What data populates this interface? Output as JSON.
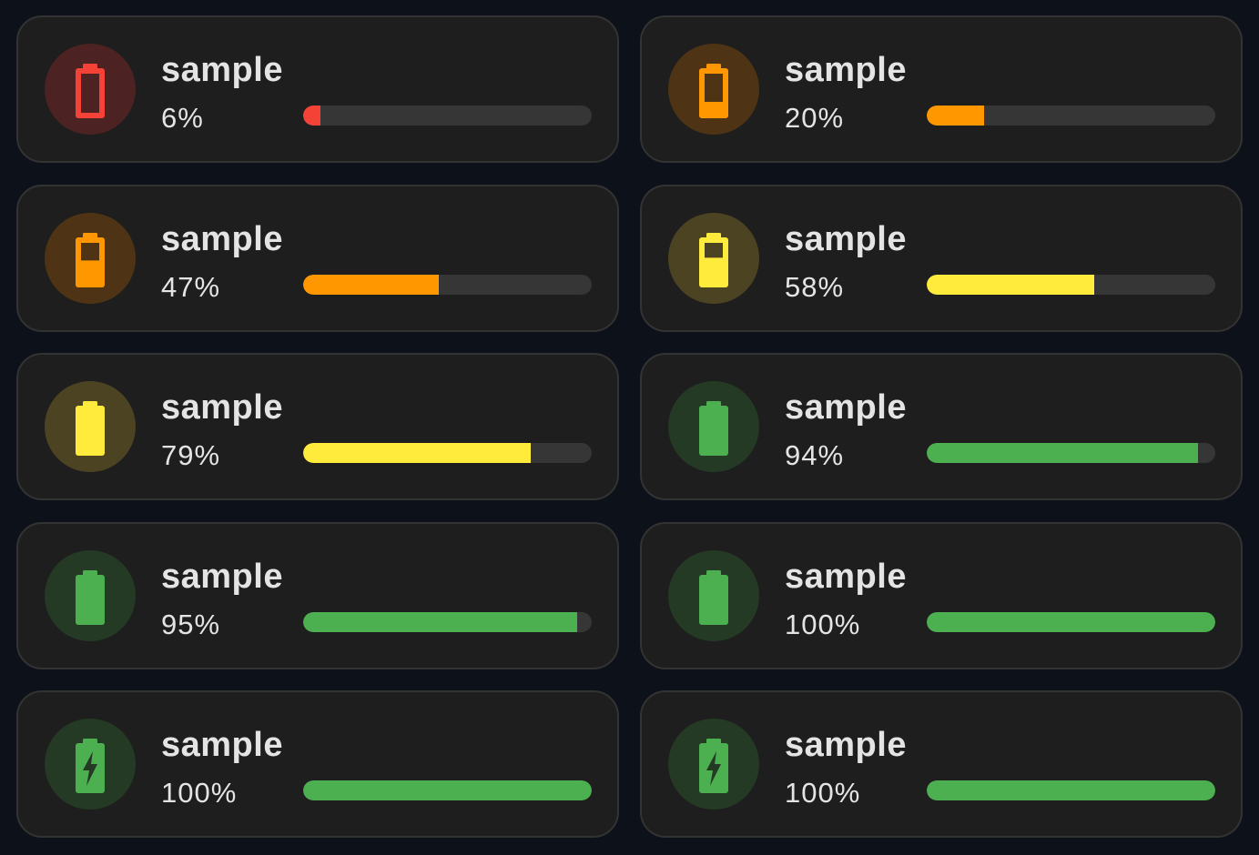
{
  "cards": [
    {
      "name": "sample",
      "percent_text": "6%",
      "level": 0.06,
      "color": "#f44336",
      "bg": "#4c2222",
      "icon": "battery-outline-icon"
    },
    {
      "name": "sample",
      "percent_text": "20%",
      "level": 0.2,
      "color": "#ff9800",
      "bg": "#4e3414",
      "icon": "battery-20-icon"
    },
    {
      "name": "sample",
      "percent_text": "47%",
      "level": 0.47,
      "color": "#ff9800",
      "bg": "#4e3414",
      "icon": "battery-50-icon"
    },
    {
      "name": "sample",
      "percent_text": "58%",
      "level": 0.58,
      "color": "#ffeb3b",
      "bg": "#4c4322",
      "icon": "battery-60-icon"
    },
    {
      "name": "sample",
      "percent_text": "79%",
      "level": 0.79,
      "color": "#ffeb3b",
      "bg": "#4c4322",
      "icon": "battery-80-icon"
    },
    {
      "name": "sample",
      "percent_text": "94%",
      "level": 0.94,
      "color": "#4caf50",
      "bg": "#243a24",
      "icon": "battery-full-icon"
    },
    {
      "name": "sample",
      "percent_text": "95%",
      "level": 0.95,
      "color": "#4caf50",
      "bg": "#243a24",
      "icon": "battery-full-icon"
    },
    {
      "name": "sample",
      "percent_text": "100%",
      "level": 1.0,
      "color": "#4caf50",
      "bg": "#243a24",
      "icon": "battery-full-icon"
    },
    {
      "name": "sample",
      "percent_text": "100%",
      "level": 1.0,
      "color": "#4caf50",
      "bg": "#243a24",
      "icon": "battery-charging-icon"
    },
    {
      "name": "sample",
      "percent_text": "100%",
      "level": 1.0,
      "color": "#4caf50",
      "bg": "#243a24",
      "icon": "battery-charging-icon"
    }
  ]
}
